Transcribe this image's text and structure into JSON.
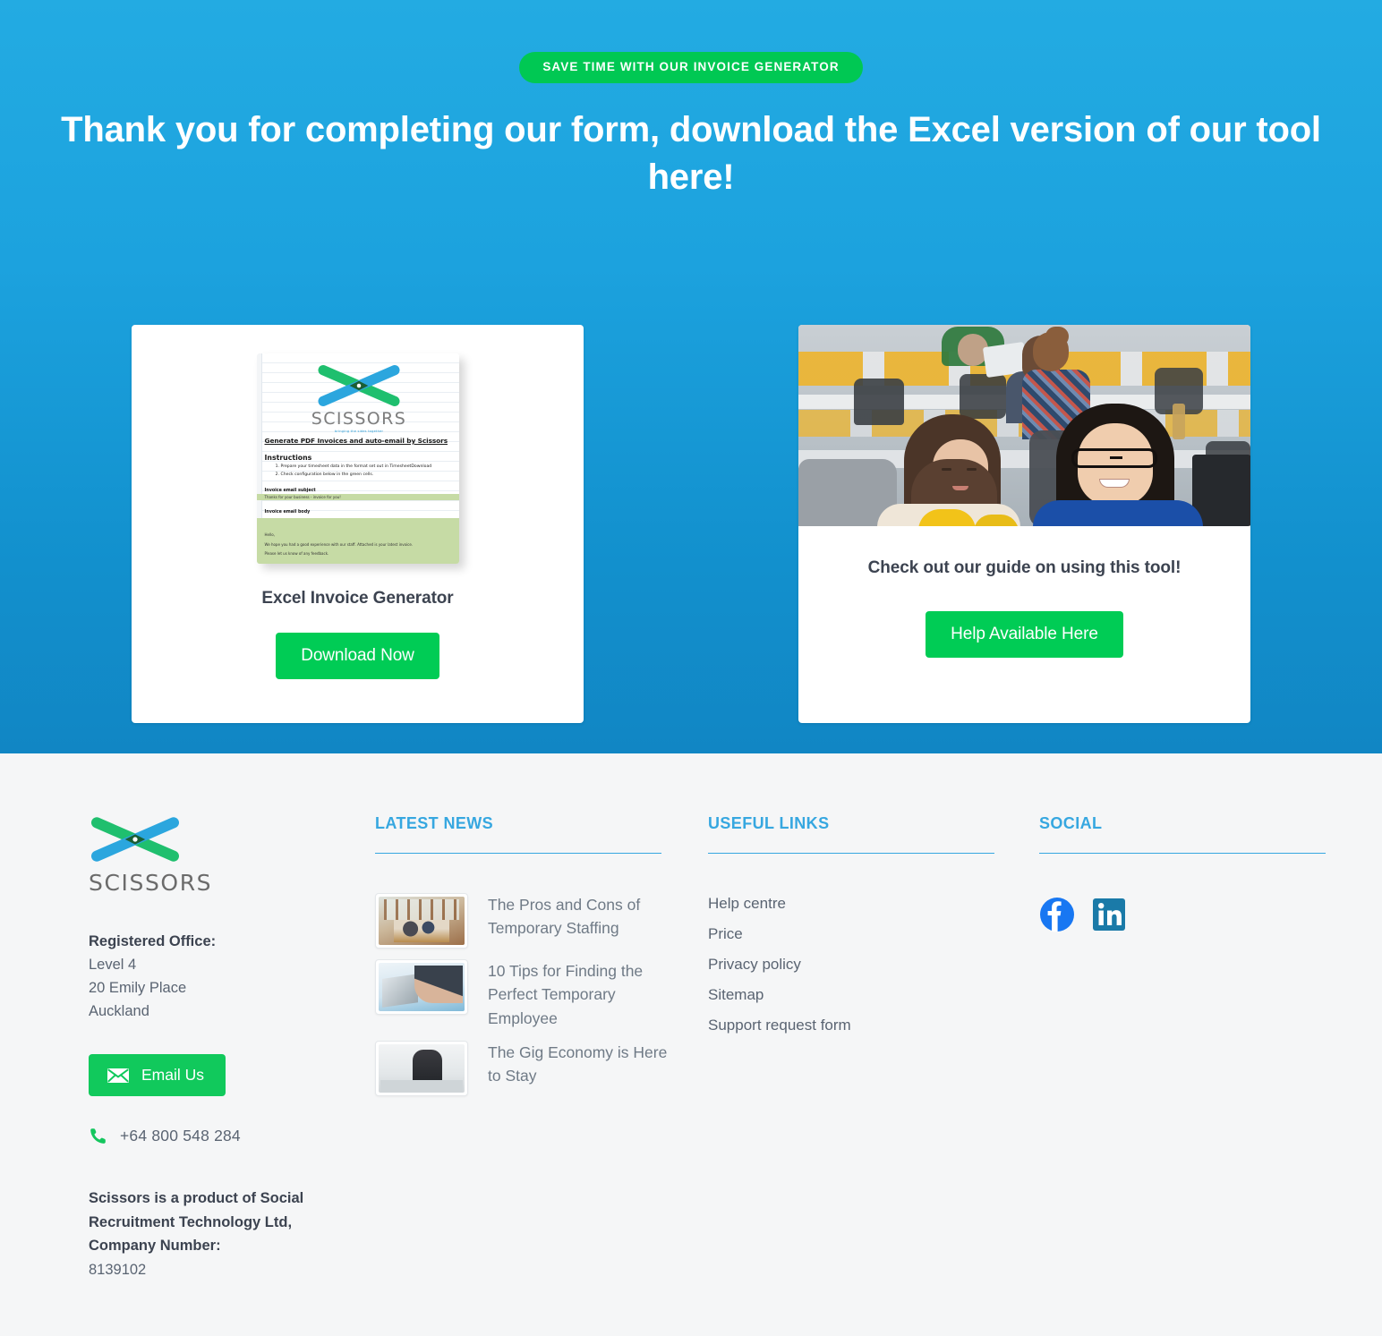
{
  "hero": {
    "eyebrow": "SAVE TIME WITH OUR INVOICE GENERATOR",
    "title": "Thank you for completing our form, download the Excel version of our tool here!",
    "bg_color_top": "#23ABE2",
    "bg_color_bottom": "#1186C4"
  },
  "cards": {
    "download": {
      "title": "Excel Invoice Generator",
      "button_label": "Download Now",
      "button_color": "#00CC55",
      "thumbnail": {
        "brand": "SCISSORS",
        "tagline": "bringing the sides together",
        "heading": "Generate PDF Invoices and auto-email by Scissors",
        "instructions_heading": "Instructions",
        "instructions": [
          "Prepare your timesheet data in the format set out in TimesheetDownload",
          "Check configuration below in the green cells."
        ],
        "subject_label": "Invoice email subject",
        "subject_value": "Thanks for your business - invoice for you!",
        "body_label": "Invoice email body",
        "body_lines": [
          "Hello,",
          "We hope you had a good experience with our staff. Attached is your latest invoice.",
          "Please let us know of any feedback."
        ],
        "cell_highlight_color": "#c6dba5"
      }
    },
    "guide": {
      "image_alt": "two-women-at-office-desk-photo",
      "title": "Check out our guide on using this tool!",
      "button_label": "Help Available Here",
      "button_color": "#00CC55"
    }
  },
  "footer": {
    "brand": {
      "name": "SCISSORS",
      "logo_green": "#1FBF6E",
      "logo_blue": "#2BA6DE"
    },
    "address": {
      "title": "Registered Office:",
      "lines": [
        "Level 4",
        "20 Emily Place",
        "Auckland"
      ]
    },
    "email_button": "Email Us",
    "phone": "+64 800 548 284",
    "legal": {
      "text": "Scissors is a product of Social Recruitment Technology Ltd, Company Number:",
      "number": "8139102"
    },
    "news": {
      "heading": "LATEST NEWS",
      "items": [
        {
          "title": "The Pros and Cons of Temporary Staffing",
          "thumb": "cafe-team-meeting-thumbnail"
        },
        {
          "title": "10 Tips for Finding the Perfect Temporary Employee",
          "thumb": "handshake-laptop-thumbnail"
        },
        {
          "title": "The Gig Economy is Here to Stay",
          "thumb": "person-working-desk-thumbnail"
        }
      ]
    },
    "links": {
      "heading": "USEFUL LINKS",
      "items": [
        "Help centre",
        "Price",
        "Privacy policy",
        "Sitemap",
        "Support request form"
      ]
    },
    "social": {
      "heading": "SOCIAL",
      "items": [
        {
          "name": "facebook",
          "color": "#1877F2"
        },
        {
          "name": "linkedin",
          "color": "#1A7AA8"
        }
      ]
    },
    "accent_color": "#36A7E0",
    "background": "#F5F6F7"
  }
}
